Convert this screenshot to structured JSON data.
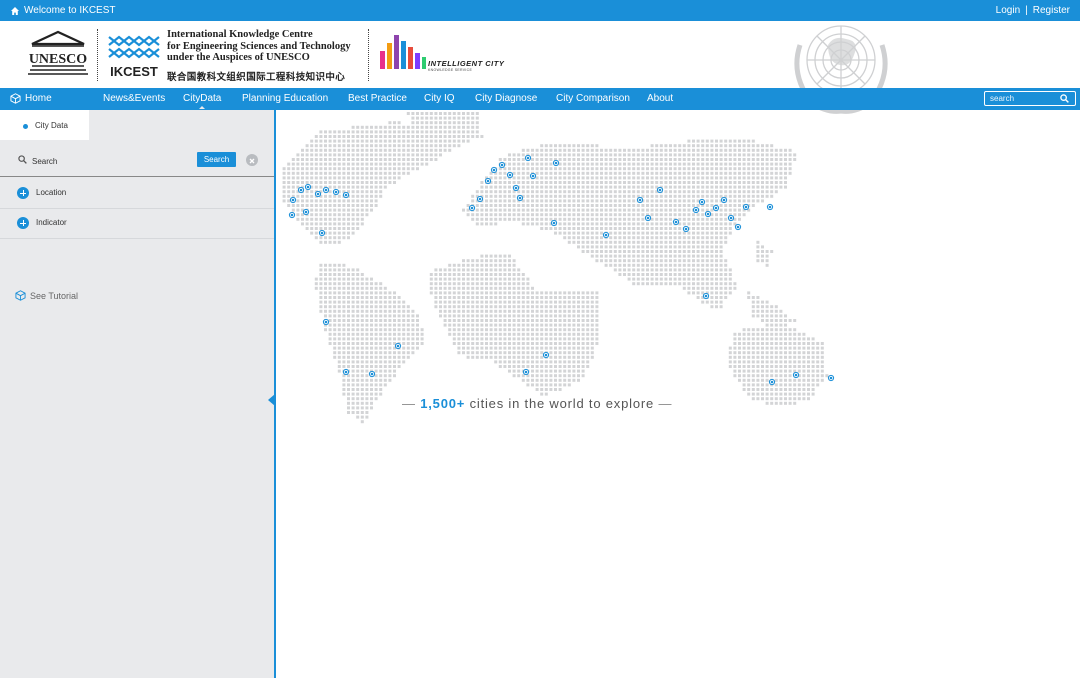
{
  "topbar": {
    "welcome": "Welcome to IKCEST",
    "login": "Login",
    "separator": "|",
    "register": "Register"
  },
  "header": {
    "unesco_logo_text": "UNESCO",
    "ikcest_title_lines": [
      "International Knowledge Centre",
      "for Engineering Sciences and Technology",
      "under the Auspices of UNESCO"
    ],
    "ikcest_acronym": "IKCEST",
    "ikcest_chinese": "联合国教科文组织国际工程科技知识中心",
    "intelligent_city_label": "INTELLIGENT CITY",
    "intelligent_city_sub": "KNOWLEDGE SERVICE"
  },
  "nav": {
    "home": "Home",
    "items": [
      {
        "label": "News&Events"
      },
      {
        "label": "CityData"
      },
      {
        "label": "Planning Education"
      },
      {
        "label": "Best Practice"
      },
      {
        "label": "City IQ"
      },
      {
        "label": "City Diagnose"
      },
      {
        "label": "City Comparison"
      },
      {
        "label": "About"
      }
    ],
    "active": "CityData",
    "search_placeholder": "search"
  },
  "sidebar": {
    "tab_label": "City Data",
    "search_placeholder": "Search",
    "search_button": "Search",
    "filters": [
      {
        "label": "Location"
      },
      {
        "label": "Indicator"
      }
    ],
    "tutorial": "See Tutorial"
  },
  "map": {
    "caption_dash": "—",
    "caption_count": "1,500+",
    "caption_text": "cities in the world to explore"
  },
  "colors": {
    "brand": "#1a8fd8",
    "sidebar_bg": "#e9eaec",
    "dot": "#d3d4d6",
    "city_dot": "#1a8fd8"
  },
  "icons": [
    "home-icon",
    "search-icon",
    "clear-icon",
    "plus-icon",
    "cube-icon",
    "un-emblem"
  ]
}
